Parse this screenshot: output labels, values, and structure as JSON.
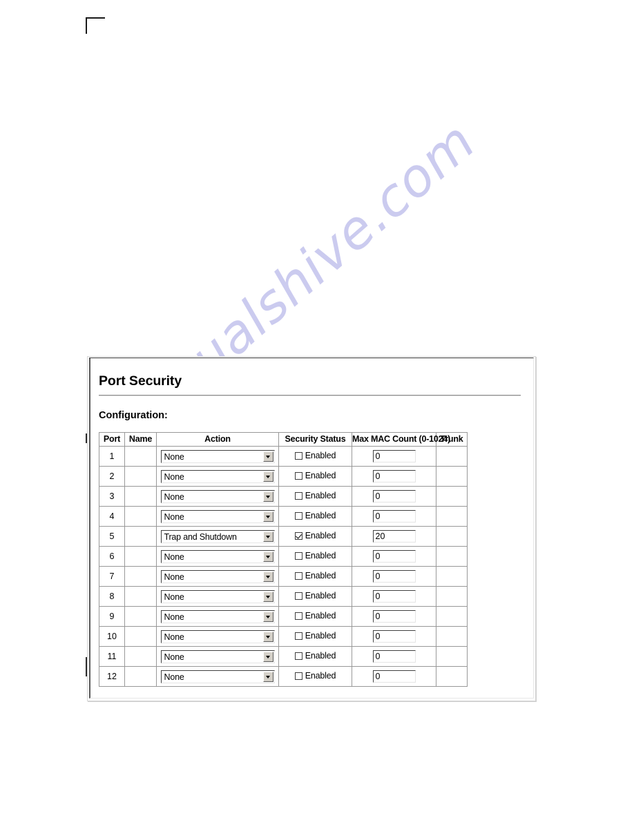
{
  "watermark": {
    "text": "manualshive.com"
  },
  "panel": {
    "title": "Port Security",
    "section_label": "Configuration:"
  },
  "table": {
    "columns": [
      {
        "key": "port",
        "label": "Port"
      },
      {
        "key": "name",
        "label": "Name"
      },
      {
        "key": "action",
        "label": "Action"
      },
      {
        "key": "status",
        "label": "Security Status"
      },
      {
        "key": "maxmac",
        "label": "Max MAC Count (0-1024)"
      },
      {
        "key": "trunk",
        "label": "Trunk"
      }
    ],
    "status_checkbox_label": "Enabled",
    "rows": [
      {
        "port": "1",
        "name": "",
        "action": "None",
        "enabled": false,
        "max_mac": "0",
        "trunk": ""
      },
      {
        "port": "2",
        "name": "",
        "action": "None",
        "enabled": false,
        "max_mac": "0",
        "trunk": ""
      },
      {
        "port": "3",
        "name": "",
        "action": "None",
        "enabled": false,
        "max_mac": "0",
        "trunk": ""
      },
      {
        "port": "4",
        "name": "",
        "action": "None",
        "enabled": false,
        "max_mac": "0",
        "trunk": ""
      },
      {
        "port": "5",
        "name": "",
        "action": "Trap and Shutdown",
        "enabled": true,
        "max_mac": "20",
        "trunk": ""
      },
      {
        "port": "6",
        "name": "",
        "action": "None",
        "enabled": false,
        "max_mac": "0",
        "trunk": ""
      },
      {
        "port": "7",
        "name": "",
        "action": "None",
        "enabled": false,
        "max_mac": "0",
        "trunk": ""
      },
      {
        "port": "8",
        "name": "",
        "action": "None",
        "enabled": false,
        "max_mac": "0",
        "trunk": ""
      },
      {
        "port": "9",
        "name": "",
        "action": "None",
        "enabled": false,
        "max_mac": "0",
        "trunk": ""
      },
      {
        "port": "10",
        "name": "",
        "action": "None",
        "enabled": false,
        "max_mac": "0",
        "trunk": ""
      },
      {
        "port": "11",
        "name": "",
        "action": "None",
        "enabled": false,
        "max_mac": "0",
        "trunk": ""
      },
      {
        "port": "12",
        "name": "",
        "action": "None",
        "enabled": false,
        "max_mac": "0",
        "trunk": ""
      }
    ]
  }
}
